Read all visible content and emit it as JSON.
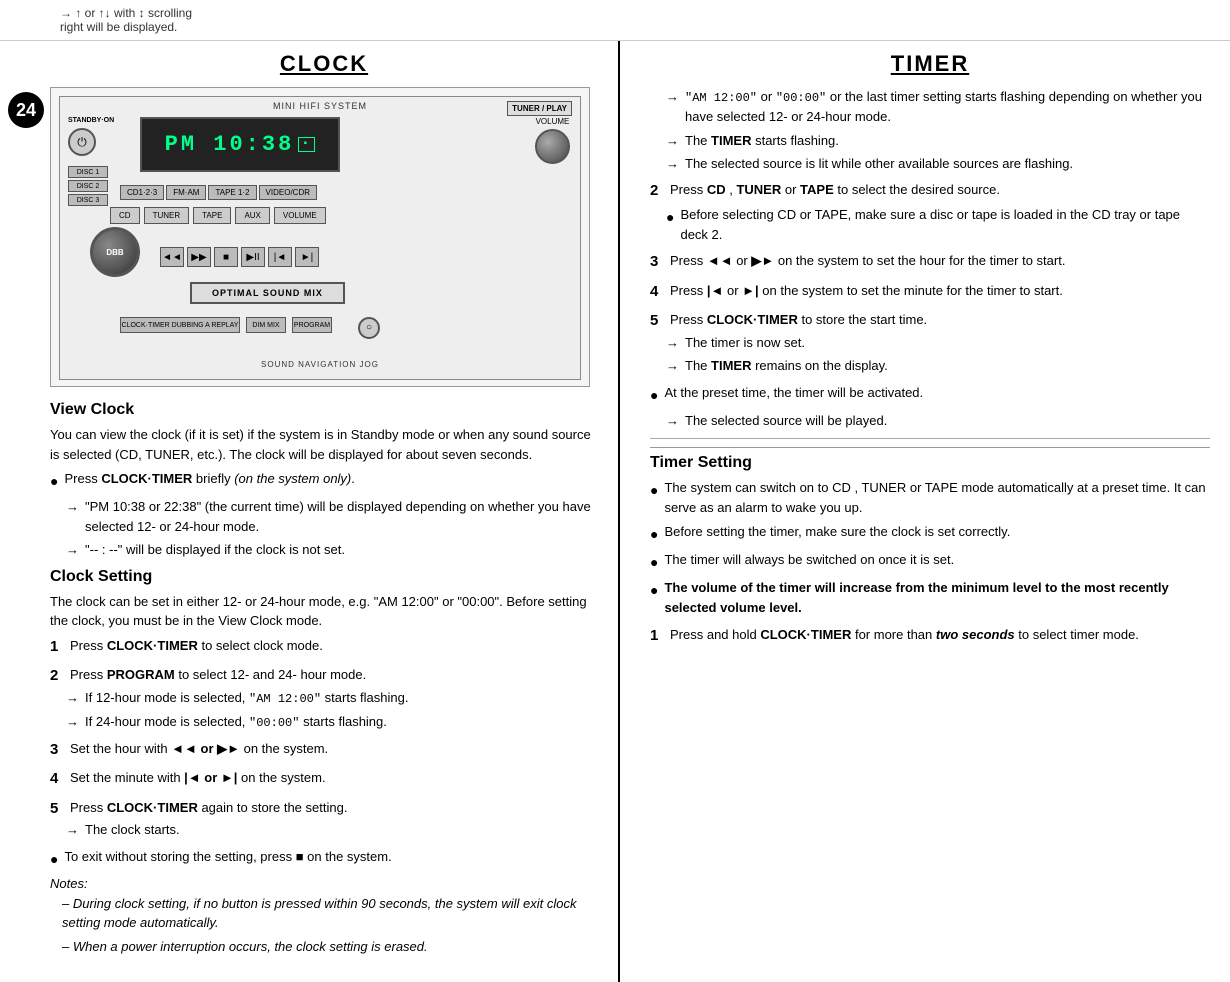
{
  "top": {
    "line1": "→  ↑  or  ↑↓  with  ↕  scrolling",
    "line2": "right will be displayed."
  },
  "page_number": "24",
  "clock_section": {
    "title": "CLOCK",
    "device": {
      "brand_label": "MINI HIFI SYSTEM",
      "top_right_label": "TUNER / PLAY",
      "display_text": "PM 10:38",
      "standby_label": "STANDBY·ON",
      "disc1_label": "DISC 1",
      "disc2_label": "DISC 2",
      "disc3_label": "DISC 3",
      "source_buttons": [
        "CD1·2·3",
        "FM·AM",
        "TAPE 1·2",
        "VIDEO/CDR"
      ],
      "ctrl_buttons": [
        "CD",
        "TUNER",
        "TAPE",
        "AUX",
        "VOLUME"
      ],
      "transport_buttons": [
        "◄◄",
        "▶▶",
        "■",
        "▶II",
        "◄◄",
        "▶►"
      ],
      "dbb_label": "DBB",
      "optimal_label": "OPTIMAL SOUND MIX",
      "nav_label": "SOUND NAVIGATION JOG",
      "bottom_row": [
        "CLOCK·TIMER DUBBING A REPLAY",
        "DIM MIX",
        "PROGRAM"
      ]
    },
    "view_clock": {
      "title": "View Clock",
      "body": "You can view the clock (if it is set) if the system is in Standby mode or when any sound source is selected (CD, TUNER, etc.). The clock will be displayed for about seven seconds.",
      "bullets": [
        {
          "type": "bullet",
          "text_parts": [
            {
              "bold": true,
              "text": "Press CLOCK·TIMER"
            },
            {
              "bold": false,
              "text": " briefly "
            },
            {
              "italic": true,
              "text": "(on the system only)"
            },
            {
              "bold": false,
              "text": "."
            }
          ],
          "text_display": "Press CLOCK·TIMER briefly (on the system only)."
        }
      ],
      "arrows": [
        {
          "text": "\"PM 10:38  or  22:38\" (the current time) will be displayed depending on whether you have selected 12- or 24-hour mode."
        },
        {
          "text": "\"-- : --\" will be displayed if the clock is not set."
        }
      ]
    },
    "clock_setting": {
      "title": "Clock Setting",
      "intro": "The clock can be set in either 12- or 24-hour mode, e.g. \"AM 12:00\" or \"00:00\". Before setting the clock, you must be in the View Clock mode.",
      "steps": [
        {
          "num": "1",
          "text": "Press CLOCK·TIMER to select clock mode.",
          "bold_part": "CLOCK·TIMER"
        },
        {
          "num": "2",
          "text": "Press PROGRAM to select 12- and 24- hour mode.",
          "bold_part": "PROGRAM",
          "arrows": [
            "If 12-hour mode is selected, \"AM 12:00\" starts flashing.",
            "If 24-hour mode is selected, \"00:00\" starts flashing."
          ]
        },
        {
          "num": "3",
          "text": "Set the hour with ◄◄ or ▶► on the system.",
          "bold_part": "◄◄ or ▶►"
        },
        {
          "num": "4",
          "text": "Set the minute with |◄ or ►| on the system.",
          "bold_part": "|◄ or ►|"
        },
        {
          "num": "5",
          "text": "Press CLOCK·TIMER again to store the setting.",
          "bold_part": "CLOCK·TIMER",
          "arrows": [
            "The clock starts."
          ]
        }
      ],
      "exit_bullet": {
        "text": "To exit without storing the setting, press ■ on the system."
      },
      "notes": {
        "label": "Notes:",
        "items": [
          "During clock setting, if no button is pressed within 90 seconds, the system will exit clock setting mode automatically.",
          "When a power interruption occurs, the clock setting is erased."
        ]
      }
    }
  },
  "timer_section": {
    "title": "TIMER",
    "intro_bullets": [
      "The system can switch on to CD , TUNER or TAPE mode automatically at a preset time. It can serve as an alarm to wake you up.",
      "Before setting the timer, make sure the clock is set correctly.",
      "The timer will always be switched on once it is set.",
      "The volume of the timer will increase from the minimum level to the most recently selected volume level."
    ],
    "timer_setting": {
      "title": "Timer Setting",
      "steps": [
        {
          "num": "1",
          "text": "Press and hold CLOCK·TIMER for more than two seconds to select timer mode.",
          "bold_parts": [
            "CLOCK·TIMER",
            "two seconds"
          ]
        }
      ]
    },
    "right_column": {
      "arrows_top": [
        "\"AM 12:00\" or \"00:00\" or the last timer setting starts flashing depending on whether you have selected 12- or 24-hour mode.",
        "The TIMER starts flashing.",
        "The selected source is lit while other available sources are flashing."
      ],
      "steps": [
        {
          "num": "2",
          "text": "Press CD , TUNER or TAPE to select the desired source.",
          "bold_parts": [
            "CD",
            "TUNER",
            "TAPE"
          ],
          "bullets": [
            "Before selecting CD or TAPE, make sure a disc or tape is loaded in the CD tray or tape deck 2."
          ]
        },
        {
          "num": "3",
          "text": "Press ◄◄ or ▶► on the system to set the hour for the timer to start.",
          "bold_parts": [
            "◄◄ or ▶►"
          ]
        },
        {
          "num": "4",
          "text": "Press |◄ or ►| on the system to set the minute for the timer to start.",
          "bold_parts": [
            "|◄ or ►|"
          ]
        },
        {
          "num": "5",
          "text": "Press CLOCK·TIMER to store the start time.",
          "bold_parts": [
            "CLOCK·TIMER"
          ],
          "arrows": [
            "The timer is now set.",
            "The TIMER remains on the display."
          ],
          "final_bullet": "At the preset time, the timer will be activated.",
          "final_arrow": "The selected source will be played."
        }
      ]
    }
  }
}
